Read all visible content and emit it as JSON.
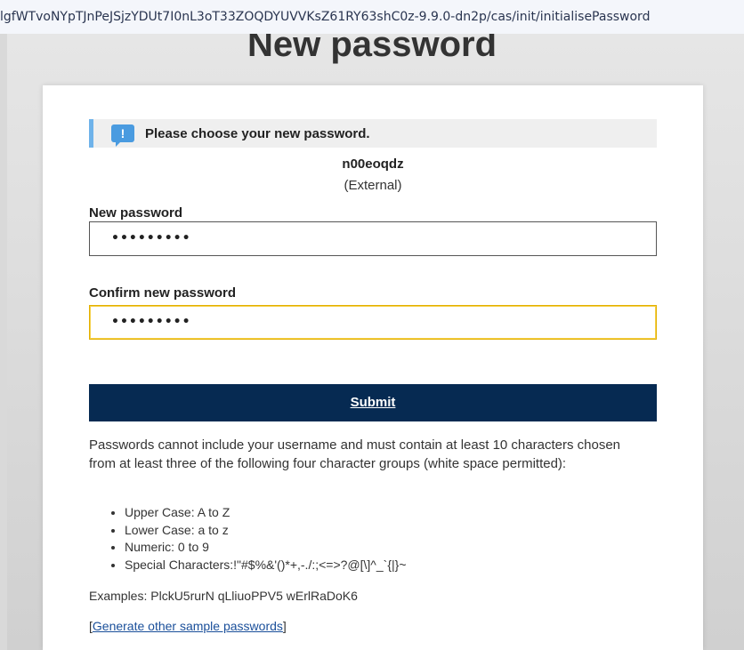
{
  "browser": {
    "url": "lgfWTvoNYpTJnPeJSjzYDUt7I0nL3oT33ZOQDYUVVKsZ61RY63shC0z-9.9.0-dn2p/cas/init/initialisePassword"
  },
  "page": {
    "title": "New password"
  },
  "notice": {
    "icon": "exclamation-speech-icon",
    "text": "Please choose your new password.",
    "accent_color": "#6fb3ea"
  },
  "user": {
    "username": "n00eoqdz",
    "type": "(External)"
  },
  "form": {
    "new_password_label": "New password",
    "new_password_value": "•••••••••",
    "confirm_password_label": "Confirm new password",
    "confirm_password_value": "•••••••••",
    "submit_label": "Submit",
    "submit_color": "#062a52",
    "focus_color": "#e3b000"
  },
  "rules": {
    "intro": "Passwords cannot include your username and must contain at least 10 characters chosen from at least three of the following four character groups (white space permitted):",
    "items": [
      "Upper Case: A to Z",
      "Lower Case: a to z",
      "Numeric: 0 to 9",
      "Special Characters:!\"#$%&'()*+,-./:;<=>?@[\\]^_`{|}~"
    ],
    "examples": "Examples: PlckU5rurN qLliuoPPV5 wErlRaDoK6",
    "generate_link_prefix": "[",
    "generate_link": "Generate other sample passwords",
    "generate_link_suffix": "]"
  }
}
